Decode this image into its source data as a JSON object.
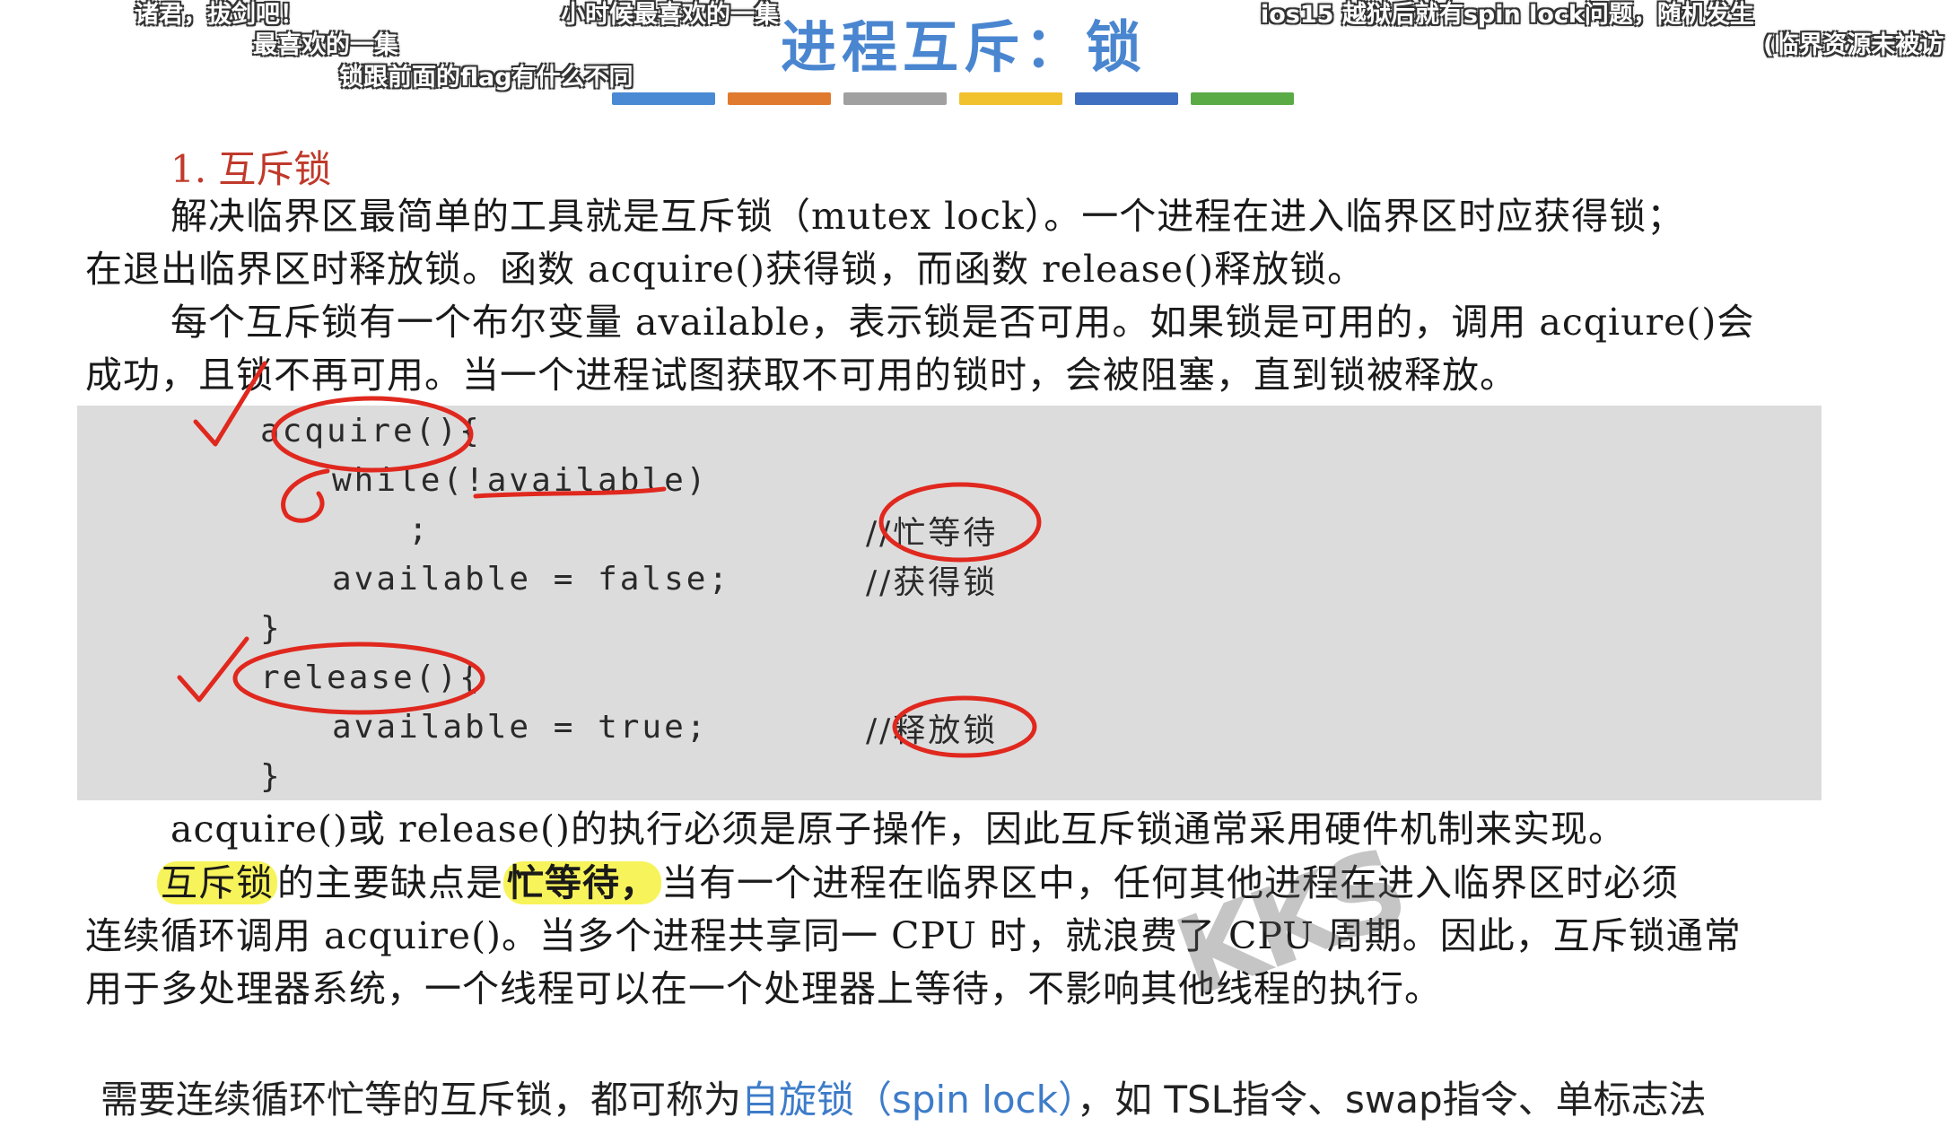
{
  "danmaku": [
    "诸君，拔剑吧！",
    "最喜欢的一集",
    "锁跟前面的flag有什么不同",
    "小时候最喜欢的一集",
    "ios15 越狱后就有spin lock问题，随机发生",
    "(临界资源未被访"
  ],
  "slide": {
    "title": "进程互斥：锁",
    "bar_colors": [
      "#4a8ad4",
      "#e07a2f",
      "#a0a0a0",
      "#f2c12e",
      "#3f6fc0",
      "#5aab46"
    ],
    "section_title": "1. 互斥锁",
    "p1_line1": "解决临界区最简单的工具就是互斥锁（mutex lock）。一个进程在进入临界区时应获得锁；",
    "p1_line2": "在退出临界区时释放锁。函数 acquire()获得锁，而函数 release()释放锁。",
    "p2_line1": "每个互斥锁有一个布尔变量 available，表示锁是否可用。如果锁是可用的，调用 acqiure()会",
    "p2_line2": "成功，且锁不再可用。当一个进程试图获取不可用的锁时，会被阻塞，直到锁被释放。",
    "code": {
      "l1": "acquire(){",
      "l2": "while(!available)",
      "l3": ";",
      "l3c": "//忙等待",
      "l4": "available = false;",
      "l4c": "//获得锁",
      "l5": "}",
      "l6": "release(){",
      "l7": "available = true;",
      "l7c": "//释放锁",
      "l8": "}"
    },
    "p3": "acquire()或 release()的执行必须是原子操作，因此互斥锁通常采用硬件机制来实现。",
    "p4_hl1": "互斥锁",
    "p4_a": "的主要缺点是",
    "p4_hl2": "忙等待，",
    "p4_b": "当有一个进程在临界区中，任何其他进程在进入临界区时必须",
    "p4_line2": "连续循环调用 acquire()。当多个进程共享同一 CPU 时，就浪费了 CPU 周期。因此，互斥锁通常",
    "p4_line3": "用于多处理器系统，一个线程可以在一个处理器上等待，不影响其他线程的执行。",
    "footer_a": "需要连续循环忙等的互斥锁，都可称为",
    "footer_spin": "自旋锁（spin lock）",
    "footer_b": "，如 TSL指令、swap指令、单标志法"
  },
  "watermark": "KKS",
  "ink_color": "#e0281e"
}
